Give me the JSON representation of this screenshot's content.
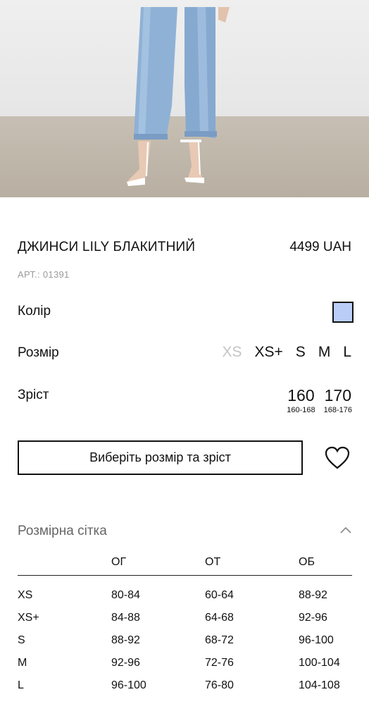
{
  "product": {
    "title": "ДЖИНСИ LILY БЛАКИТНИЙ",
    "price": "4499 UAH",
    "article": "АРТ.: 01391",
    "image_icon": "product-photo"
  },
  "color": {
    "label": "Колір",
    "swatch": "#b9cdf7"
  },
  "size": {
    "label": "Розмір",
    "options": [
      {
        "label": "XS",
        "available": false
      },
      {
        "label": "XS+",
        "available": true
      },
      {
        "label": "S",
        "available": true
      },
      {
        "label": "M",
        "available": true
      },
      {
        "label": "L",
        "available": true
      }
    ]
  },
  "height": {
    "label": "Зріст",
    "options": [
      {
        "label": "160",
        "range": "160-168"
      },
      {
        "label": "170",
        "range": "168-176"
      }
    ]
  },
  "cta": {
    "label": "Виберіть розмір та зріст",
    "wishlist_icon": "heart-icon"
  },
  "size_chart": {
    "title": "Розмірна сітка",
    "toggle_icon": "chevron-up-icon",
    "headers": [
      "",
      "ОГ",
      "ОТ",
      "ОБ"
    ],
    "rows": [
      [
        "XS",
        "80-84",
        "60-64",
        "88-92"
      ],
      [
        "XS+",
        "84-88",
        "64-68",
        "92-96"
      ],
      [
        "S",
        "88-92",
        "68-72",
        "96-100"
      ],
      [
        "M",
        "92-96",
        "72-76",
        "100-104"
      ],
      [
        "L",
        "96-100",
        "76-80",
        "104-108"
      ]
    ]
  }
}
